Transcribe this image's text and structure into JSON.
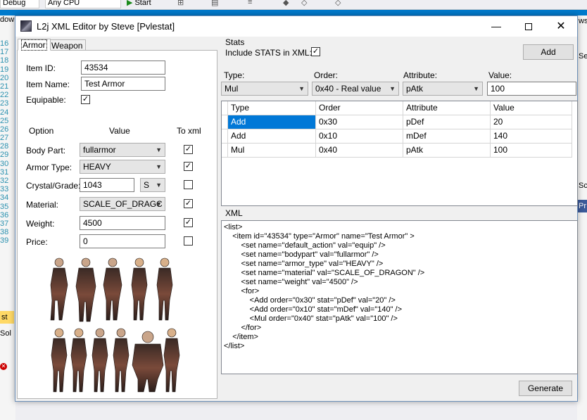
{
  "ide": {
    "toolbar": {
      "config": "Debug",
      "platform": "Any CPU",
      "start": "Start"
    },
    "left_tab": "dow",
    "line_numbers": [
      "16",
      "17",
      "18",
      "19",
      "20",
      "21",
      "22",
      "23",
      "24",
      "25",
      "26",
      "27",
      "28",
      "29",
      "30",
      "31",
      "32",
      "33",
      "34",
      "35",
      "36",
      "37",
      "38",
      "39"
    ],
    "tab_st": "st",
    "tab_sol": "Sol",
    "right_tags": [
      "wsF",
      "Se",
      "Sc",
      "Pr"
    ]
  },
  "window": {
    "title": "L2j XML Editor by Steve [Pvlestat]",
    "minimize": "—",
    "close": "✕"
  },
  "tabs": {
    "armor": "Armor",
    "weapon": "Weapon"
  },
  "armor": {
    "item_id_label": "Item ID:",
    "item_id": "43534",
    "item_name_label": "Item Name:",
    "item_name": "Test Armor",
    "equipable_label": "Equipable:",
    "col_option": "Option",
    "col_value": "Value",
    "col_toxml": "To xml",
    "body_part_label": "Body Part:",
    "body_part": "fullarmor",
    "armor_type_label": "Armor Type:",
    "armor_type": "HEAVY",
    "crystal_label": "Crystal/Grade:",
    "crystal": "1043",
    "grade": "S",
    "material_label": "Material:",
    "material": "SCALE_OF_DRAGC",
    "weight_label": "Weight:",
    "weight": "4500",
    "price_label": "Price:",
    "price": "0"
  },
  "stats": {
    "group_title": "Stats",
    "include_label": "Include STATS in XML:",
    "add_button": "Add",
    "type_label": "Type:",
    "type_value": "Mul",
    "order_label": "Order:",
    "order_value": "0x40 - Real value",
    "attribute_label": "Attribute:",
    "attribute_value": "pAtk",
    "value_label": "Value:",
    "value_value": "100",
    "grid": {
      "columns": [
        "Type",
        "Order",
        "Attribute",
        "Value"
      ],
      "rows": [
        [
          "Add",
          "0x30",
          "pDef",
          "20"
        ],
        [
          "Add",
          "0x10",
          "mDef",
          "140"
        ],
        [
          "Mul",
          "0x40",
          "pAtk",
          "100"
        ]
      ]
    }
  },
  "xml": {
    "group_title": "XML",
    "lines": [
      "<list>",
      "    <item id=\"43534\" type=\"Armor\" name=\"Test Armor\" >",
      "        <set name=\"default_action\" val=\"equip\" />",
      "        <set name=\"bodypart\" val=\"fullarmor\" />",
      "        <set name=\"armor_type\" val=\"HEAVY\" />",
      "        <set name=\"material\" val=\"SCALE_OF_DRAGON\" />",
      "        <set name=\"weight\" val=\"4500\" />",
      "        <for>",
      "            <Add order=\"0x30\" stat=\"pDef\" val=\"20\" />",
      "            <Add order=\"0x10\" stat=\"mDef\" val=\"140\" />",
      "            <Mul order=\"0x40\" stat=\"pAtk\" val=\"100\" />",
      "        </for>",
      "    </item>",
      "</list>"
    ]
  },
  "generate_button": "Generate",
  "colors": {
    "accent_blue": "#007acc",
    "selection": "#0078d7",
    "window_bg": "#f0f0f0"
  }
}
